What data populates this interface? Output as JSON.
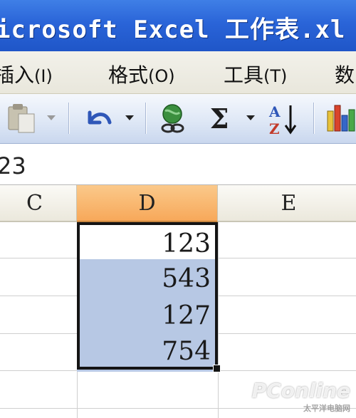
{
  "window": {
    "title": "icrosoft Excel 工作表.xl"
  },
  "menu": {
    "items": [
      {
        "label": "插入",
        "key": "(I)"
      },
      {
        "label": "格式",
        "key": "(O)"
      },
      {
        "label": "工具",
        "key": "(T)"
      },
      {
        "label": "数"
      }
    ]
  },
  "toolbar": {
    "sum_symbol": "Σ",
    "sort_label": "A↓Z"
  },
  "formula_bar": {
    "value": "23"
  },
  "columns": [
    "C",
    "D",
    "E"
  ],
  "active_column": "D",
  "cells": {
    "D": [
      "123",
      "543",
      "127",
      "754"
    ]
  },
  "watermark": {
    "brand": "PConline",
    "sub": "太平洋电脑网"
  }
}
